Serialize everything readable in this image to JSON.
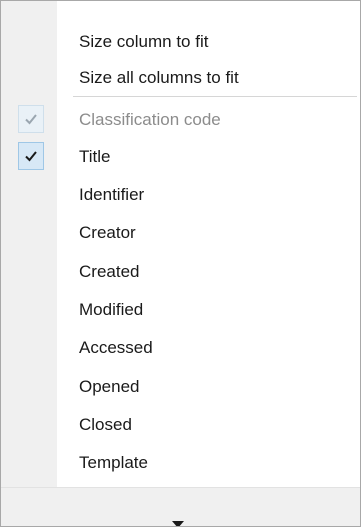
{
  "menu": {
    "items": [
      {
        "label": "Size column to fit",
        "checked": false,
        "enabled": true
      },
      {
        "label": "Size all columns to fit",
        "checked": false,
        "enabled": true
      },
      {
        "label": "Classification code",
        "checked": true,
        "enabled": false
      },
      {
        "label": "Title",
        "checked": true,
        "enabled": true
      },
      {
        "label": "Identifier",
        "checked": false,
        "enabled": true
      },
      {
        "label": "Creator",
        "checked": false,
        "enabled": true
      },
      {
        "label": "Created",
        "checked": false,
        "enabled": true
      },
      {
        "label": "Modified",
        "checked": false,
        "enabled": true
      },
      {
        "label": "Accessed",
        "checked": false,
        "enabled": true
      },
      {
        "label": "Opened",
        "checked": false,
        "enabled": true
      },
      {
        "label": "Closed",
        "checked": false,
        "enabled": true
      },
      {
        "label": "Template",
        "checked": false,
        "enabled": true
      }
    ],
    "scroll_down_icon": "triangle-down-icon"
  },
  "colors": {
    "check_bg": "#d7e8f6",
    "check_border": "#9fc7e6",
    "disabled_text": "#8c8c8c",
    "text": "#1a1a1a"
  }
}
